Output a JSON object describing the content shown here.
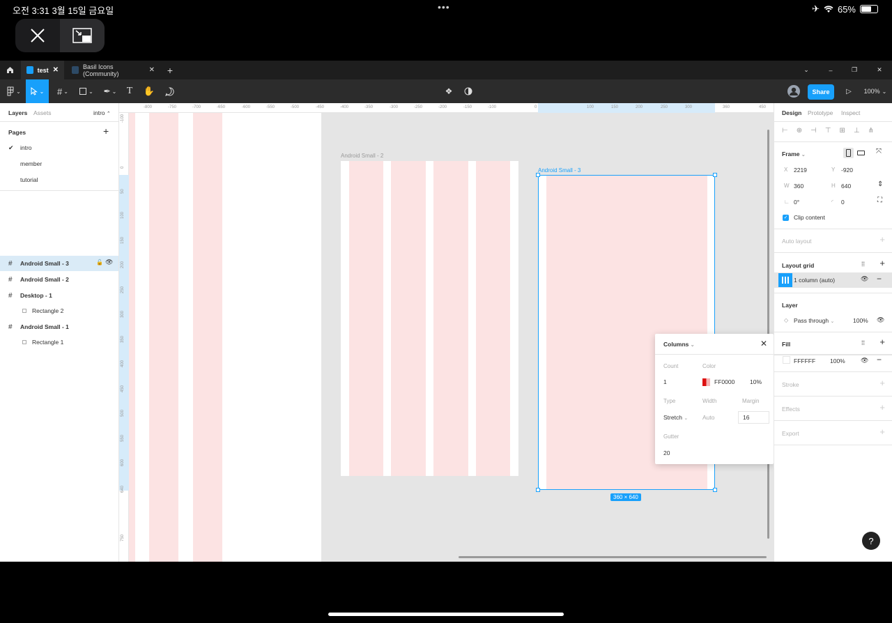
{
  "status_bar": {
    "time": "오전 3:31   3월 15일 금요일",
    "dots": "•••",
    "battery": "65%"
  },
  "tabs": [
    {
      "label": "test"
    },
    {
      "label": "Basil Icons (Community)"
    }
  ],
  "toolbar": {
    "share": "Share",
    "zoom": "100%"
  },
  "left_panel": {
    "tabs": [
      "Layers",
      "Assets"
    ],
    "page_selector": "intro",
    "pages_title": "Pages",
    "pages": [
      "intro",
      "member",
      "tutorial"
    ],
    "layers": [
      "Android Small - 3",
      "Android Small - 2",
      "Desktop - 1",
      "Rectangle 2",
      "Android Small - 1",
      "Rectangle 1"
    ]
  },
  "canvas": {
    "ruler_top": [
      "-800",
      "-750",
      "-700",
      "-650",
      "-600",
      "-550",
      "-500",
      "-450",
      "-400",
      "-350",
      "-300",
      "-250",
      "-200",
      "-150",
      "-100",
      "0",
      "100",
      "150",
      "200",
      "250",
      "300",
      "360",
      "450"
    ],
    "ruler_left": [
      "-100",
      "0",
      "50",
      "100",
      "150",
      "200",
      "250",
      "300",
      "350",
      "400",
      "450",
      "500",
      "550",
      "600",
      "640",
      "750"
    ],
    "frame2_label": "Android Small - 2",
    "frame3_label": "Android Small - 3",
    "size_badge": "360 × 640"
  },
  "popup": {
    "title": "Columns",
    "count_label": "Count",
    "color_label": "Color",
    "count": "1",
    "color_hex": "FF0000",
    "color_opacity": "10%",
    "type_label": "Type",
    "width_label": "Width",
    "margin_label": "Margin",
    "type": "Stretch",
    "width": "Auto",
    "margin": "16",
    "gutter_label": "Gutter",
    "gutter": "20"
  },
  "right_panel": {
    "tabs": [
      "Design",
      "Prototype",
      "Inspect"
    ],
    "frame_title": "Frame",
    "x_label": "X",
    "x": "2219",
    "y_label": "Y",
    "y": "-920",
    "w_label": "W",
    "w": "360",
    "h_label": "H",
    "h": "640",
    "rotation": "0°",
    "radius": "0",
    "clip_content": "Clip content",
    "auto_layout": "Auto layout",
    "layout_grid": "Layout grid",
    "grid_item": "1 column (auto)",
    "layer": "Layer",
    "blend": "Pass through",
    "layer_opacity": "100%",
    "fill": "Fill",
    "fill_hex": "FFFFFF",
    "fill_opacity": "100%",
    "stroke": "Stroke",
    "effects": "Effects",
    "export": "Export"
  },
  "help": "?"
}
